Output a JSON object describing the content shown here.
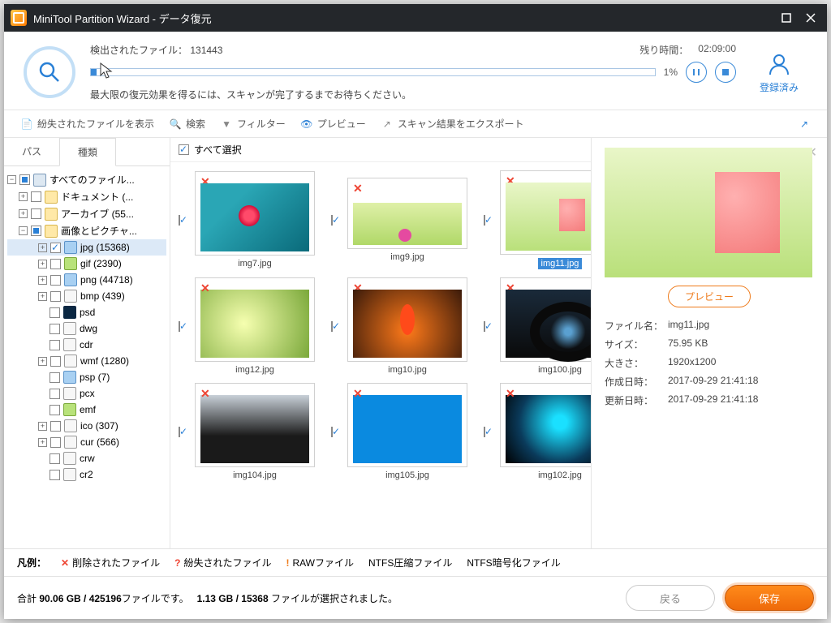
{
  "title": "MiniTool Partition Wizard - データ復元",
  "scan": {
    "found_label": "検出されたファイル：",
    "found_count": "131443",
    "remain_label": "残り時間：",
    "remain_time": "02:09:00",
    "percent": "1%",
    "hint": "最大限の復元効果を得るには、スキャンが完了するまでお待ちください。",
    "registered": "登録済み"
  },
  "toolbar": {
    "lost": "紛失されたファイルを表示",
    "search": "検索",
    "filter": "フィルター",
    "preview": "プレビュー",
    "export": "スキャン結果をエクスポート"
  },
  "tabs": {
    "path": "パス",
    "type": "種類"
  },
  "tree": {
    "root": "すべてのファイル...",
    "docs": "ドキュメント (...",
    "arch": "アーカイブ (55...",
    "imgs": "画像とピクチャ...",
    "items": [
      {
        "label": "jpg (15368)"
      },
      {
        "label": "gif (2390)"
      },
      {
        "label": "png (44718)"
      },
      {
        "label": "bmp (439)"
      },
      {
        "label": "psd"
      },
      {
        "label": "dwg"
      },
      {
        "label": "cdr"
      },
      {
        "label": "wmf (1280)"
      },
      {
        "label": "psp (7)"
      },
      {
        "label": "pcx"
      },
      {
        "label": "emf"
      },
      {
        "label": "ico (307)"
      },
      {
        "label": "cur (566)"
      },
      {
        "label": "crw"
      },
      {
        "label": "cr2"
      }
    ]
  },
  "selall": "すべて選択",
  "thumbs": [
    {
      "name": "img7.jpg"
    },
    {
      "name": "img9.jpg"
    },
    {
      "name": "img11.jpg"
    },
    {
      "name": "img12.jpg"
    },
    {
      "name": "img10.jpg"
    },
    {
      "name": "img100.jpg"
    },
    {
      "name": "img104.jpg"
    },
    {
      "name": "img105.jpg"
    },
    {
      "name": "img102.jpg"
    }
  ],
  "preview": {
    "btn": "プレビュー",
    "filename_l": "ファイル名：",
    "filename": "img11.jpg",
    "size_l": "サイズ：",
    "size": "75.95 KB",
    "dim_l": "大きさ：",
    "dim": "1920x1200",
    "created_l": "作成日時：",
    "created": "2017-09-29 21:41:18",
    "updated_l": "更新日時：",
    "updated": "2017-09-29 21:41:18"
  },
  "legend": {
    "title": "凡例：",
    "deleted": "削除されたファイル",
    "lost": "紛失されたファイル",
    "raw": "RAWファイル",
    "ntfs_c": "NTFS圧縮ファイル",
    "ntfs_e": "NTFS暗号化ファイル"
  },
  "footer": {
    "total_a": "合計 ",
    "total_b": "90.06 GB / 425196",
    "total_c": "ファイルです。",
    "sel_a": "1.13 GB / 15368 ",
    "sel_b": "ファイルが選択されました。",
    "back": "戻る",
    "save": "保存"
  }
}
